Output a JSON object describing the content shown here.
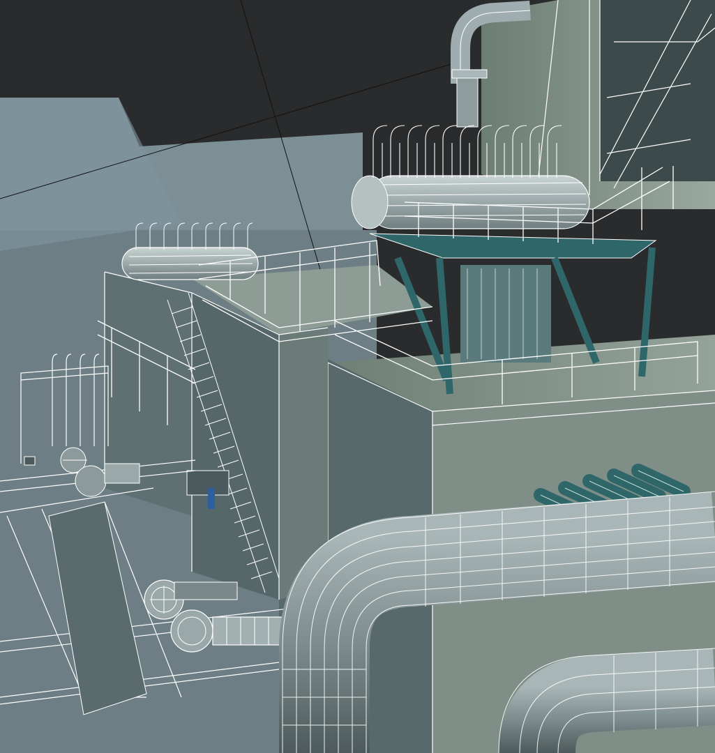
{
  "viewport": {
    "render_mode": "shaded-wireframe",
    "colors": {
      "background": "#2a2b2c",
      "wire": "#ffffff",
      "ground": "#6d7f84",
      "sky_plane": "#7b8f95",
      "building_light": "#86968e",
      "building_dark": "#4f5f60",
      "pipe": "#7c8b8d",
      "teal_accent": "#2f6669"
    }
  },
  "scene": {
    "objects": [
      "ground-plane",
      "terrain-slope",
      "main-building-block",
      "left-annex-block",
      "rear-tower",
      "exhaust-pipe-top",
      "manifold-tank-right",
      "manifold-tank-left",
      "platform-railings",
      "staircase",
      "cooling-fin-rack",
      "pipe-rack-left",
      "rails",
      "large-u-pipe",
      "lower-pipe",
      "valve-assembly-front",
      "valve-assembly-left"
    ]
  }
}
